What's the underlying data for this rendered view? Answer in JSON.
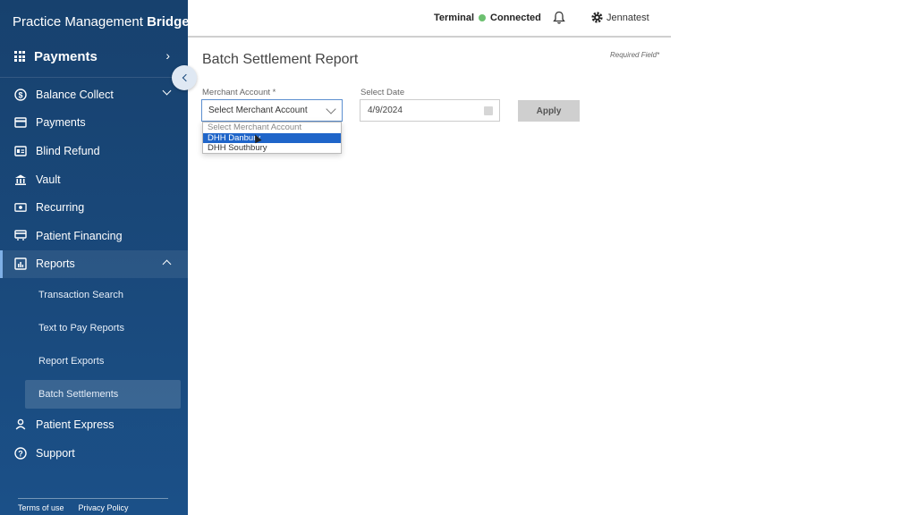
{
  "brand": {
    "name_regular": "Practice Management ",
    "name_bold": "Bridge",
    "mark": "®"
  },
  "app_switch": {
    "label": "Payments"
  },
  "nav": {
    "balance_collect": "Balance Collect",
    "payments": "Payments",
    "blind_refund": "Blind Refund",
    "vault": "Vault",
    "recurring": "Recurring",
    "patient_financing": "Patient Financing",
    "reports": "Reports",
    "reports_sub": [
      "Transaction Search",
      "Text to Pay Reports",
      "Report Exports",
      "Batch Settlements"
    ],
    "patient_express": "Patient Express",
    "support": "Support"
  },
  "footer": {
    "terms": "Terms of use",
    "privacy": "Privacy Policy"
  },
  "topbar": {
    "terminal_label": "Terminal",
    "status": "Connected",
    "status_color": "#6cc070",
    "user": "Jennatest"
  },
  "main": {
    "title": "Batch Settlement Report",
    "required_note": "Required Field*",
    "merchant_label": "Merchant Account *",
    "merchant_value": "Select Merchant Account",
    "merchant_options": [
      "Select Merchant Account",
      "DHH Danbury",
      "DHH Southbury"
    ],
    "date_label": "Select Date",
    "date_value": "4/9/2024",
    "apply_label": "Apply"
  },
  "colors": {
    "sidebar": "#1a4a7d",
    "accent": "#1f65c9"
  }
}
